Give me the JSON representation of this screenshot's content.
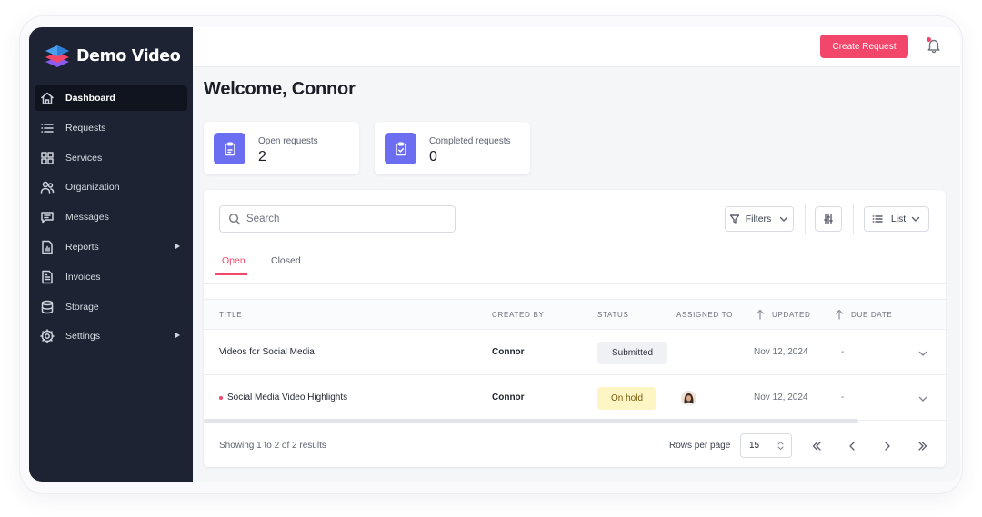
{
  "brand": {
    "name": "Demo Video",
    "logo_icon": "layers-logo-icon",
    "logo_colors": [
      "#4a9ff0",
      "#f2476a",
      "#8c5cf0"
    ]
  },
  "sidebar": {
    "items": [
      {
        "label": "Dashboard",
        "icon": "home-icon",
        "active": true
      },
      {
        "label": "Requests",
        "icon": "list-icon"
      },
      {
        "label": "Services",
        "icon": "grid-icon"
      },
      {
        "label": "Organization",
        "icon": "users-icon"
      },
      {
        "label": "Messages",
        "icon": "message-icon"
      },
      {
        "label": "Reports",
        "icon": "report-icon",
        "has_submenu": true
      },
      {
        "label": "Invoices",
        "icon": "invoice-icon"
      },
      {
        "label": "Storage",
        "icon": "database-icon"
      },
      {
        "label": "Settings",
        "icon": "gear-icon",
        "has_submenu": true
      }
    ]
  },
  "topbar": {
    "create_label": "Create Request",
    "bell_icon": "bell-icon"
  },
  "colors": {
    "accent": "#f2476a",
    "sidebar_bg": "#1d2333",
    "stat_icon_bg": "#6b6ef0",
    "submitted_bg": "#f0f1f4",
    "onhold_bg": "#fdf5c4"
  },
  "welcome": "Welcome, Connor",
  "stats": [
    {
      "label": "Open requests",
      "value": "2",
      "icon": "clipboard-icon"
    },
    {
      "label": "Completed requests",
      "value": "0",
      "icon": "clipboard-check-icon"
    }
  ],
  "search": {
    "placeholder": "Search"
  },
  "toolbar": {
    "filters_label": "Filters",
    "view_label": "List"
  },
  "tabs": [
    {
      "label": "Open",
      "active": true
    },
    {
      "label": "Closed"
    }
  ],
  "table": {
    "columns": [
      "TITLE",
      "CREATED BY",
      "STATUS",
      "ASSIGNED TO",
      "UPDATED",
      "DUE DATE"
    ],
    "rows": [
      {
        "title": "Videos for Social Media",
        "created_by": "Connor",
        "status": "Submitted",
        "assigned_to": "",
        "updated": "Nov 12, 2024",
        "due": "-",
        "unread": false
      },
      {
        "title": "Social Media Video Highlights",
        "created_by": "Connor",
        "status": "On hold",
        "assigned_to": "avatar",
        "updated": "Nov 12, 2024",
        "due": "-",
        "unread": true
      }
    ]
  },
  "footer": {
    "showing": "Showing 1 to 2 of 2 results",
    "rows_per_page_label": "Rows per page",
    "rows_per_page": "15"
  }
}
